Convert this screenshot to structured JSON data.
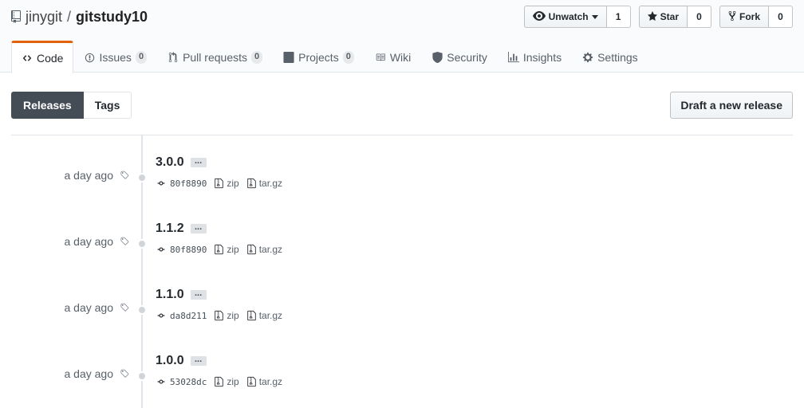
{
  "repo": {
    "owner": "jinygit",
    "separator": "/",
    "name": "gitstudy10"
  },
  "actions": {
    "watch": {
      "label": "Unwatch",
      "count": "1"
    },
    "star": {
      "label": "Star",
      "count": "0"
    },
    "fork": {
      "label": "Fork",
      "count": "0"
    }
  },
  "tabs": [
    {
      "label": "Code",
      "icon": "code-icon",
      "counter": null,
      "selected": true
    },
    {
      "label": "Issues",
      "icon": "issue-icon",
      "counter": "0"
    },
    {
      "label": "Pull requests",
      "icon": "pull-request-icon",
      "counter": "0"
    },
    {
      "label": "Projects",
      "icon": "project-icon",
      "counter": "0"
    },
    {
      "label": "Wiki",
      "icon": "book-icon",
      "counter": null
    },
    {
      "label": "Security",
      "icon": "shield-icon",
      "counter": null
    },
    {
      "label": "Insights",
      "icon": "graph-icon",
      "counter": null
    },
    {
      "label": "Settings",
      "icon": "gear-icon",
      "counter": null
    }
  ],
  "subnav": {
    "releases": "Releases",
    "tags": "Tags",
    "draft_button": "Draft a new release"
  },
  "releases": [
    {
      "time": "a day ago",
      "version": "3.0.0",
      "ellipsis": "...",
      "commit": "80f8890",
      "zip": "zip",
      "targz": "tar.gz"
    },
    {
      "time": "a day ago",
      "version": "1.1.2",
      "ellipsis": "...",
      "commit": "80f8890",
      "zip": "zip",
      "targz": "tar.gz"
    },
    {
      "time": "a day ago",
      "version": "1.1.0",
      "ellipsis": "...",
      "commit": "da8d211",
      "zip": "zip",
      "targz": "tar.gz"
    },
    {
      "time": "a day ago",
      "version": "1.0.0",
      "ellipsis": "...",
      "commit": "53028dc",
      "zip": "zip",
      "targz": "tar.gz"
    }
  ],
  "colors": {
    "accent_tab": "#e36209",
    "link": "#0366d6",
    "selected_subnav": "#444d56"
  }
}
